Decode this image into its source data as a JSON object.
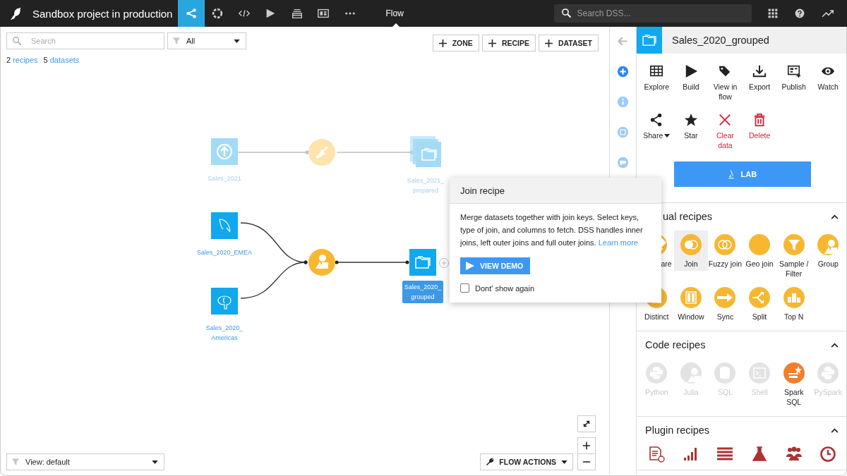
{
  "topbar": {
    "project_title": "Sandbox project in production",
    "nav": [
      {
        "kind": "flow",
        "selected": true
      },
      {
        "kind": "ring",
        "selected": false
      },
      {
        "kind": "code",
        "selected": false
      },
      {
        "kind": "play",
        "selected": false
      },
      {
        "kind": "stack",
        "selected": false
      },
      {
        "kind": "dashboard",
        "selected": false
      },
      {
        "kind": "more",
        "selected": false
      }
    ],
    "page_label": "Flow",
    "search_placeholder": "Search DSS..."
  },
  "toolbar": {
    "search_placeholder": "Search",
    "filter_value": "All",
    "buttons": [
      "ZONE",
      "RECIPE",
      "DATASET"
    ]
  },
  "counts": [
    {
      "number": "2",
      "label": "recipes"
    },
    {
      "number": "5",
      "label": "datasets"
    }
  ],
  "flow": {
    "nodes": [
      {
        "kind": "upload",
        "label": "Sales_2021",
        "faded": true,
        "selected": false
      },
      {
        "kind": "prepare",
        "faded": true
      },
      {
        "kind": "folder-stack",
        "label": "Sales_2021_\nprepared",
        "faded": true,
        "selected": false
      },
      {
        "kind": "dolphin",
        "label": "Sales_2020_EMEA",
        "faded": false,
        "selected": false
      },
      {
        "kind": "group",
        "faded": false
      },
      {
        "kind": "folder",
        "label": "Sales_2020_\ngrouped",
        "faded": false,
        "selected": true
      },
      {
        "kind": "elephant",
        "label": "Sales_2020_\nAmericas",
        "faded": false,
        "selected": false
      }
    ]
  },
  "bottom": {
    "view_value": "View: default",
    "flow_actions": "FLOW ACTIONS"
  },
  "popover": {
    "title": "Join recipe",
    "text": "Merge datasets together with join keys. Select keys, type of join, and columns to fetch. DSS handles inner joins, left outer joins and full outer joins.",
    "link": "Learn more",
    "button": "VIEW DEMO",
    "dont_show_again": {
      "label": "Dont' show again",
      "checked": false
    }
  },
  "panel": {
    "title": "Sales_2020_grouped",
    "actions": [
      {
        "kind": "table",
        "label": "Explore",
        "danger": false
      },
      {
        "kind": "play",
        "label": "Build",
        "danger": false
      },
      {
        "kind": "tag",
        "label": "View in flow",
        "danger": false
      },
      {
        "kind": "download",
        "label": "Export",
        "danger": false
      },
      {
        "kind": "publish",
        "label": "Publish",
        "danger": false
      },
      {
        "kind": "eye",
        "label": "Watch",
        "danger": false
      },
      {
        "kind": "share",
        "label": "Share",
        "danger": false
      },
      {
        "kind": "star",
        "label": "Star",
        "danger": false
      },
      {
        "kind": "cross",
        "label": "Clear data",
        "danger": true
      },
      {
        "kind": "trash",
        "label": "Delete",
        "danger": true
      }
    ],
    "lab_button": "LAB",
    "sections": [
      {
        "title": "ual recipes",
        "expanded": true,
        "items": [
          {
            "kind": "prepare",
            "label": "are",
            "selected": false
          },
          {
            "kind": "join",
            "label": "Join",
            "selected": true
          },
          {
            "kind": "fuzzy",
            "label": "Fuzzy join",
            "selected": false
          },
          {
            "kind": "geo",
            "label": "Geo join",
            "selected": false
          },
          {
            "kind": "funnel",
            "label": "Sample / Filter",
            "selected": false
          },
          {
            "kind": "group",
            "label": "Group",
            "selected": false
          },
          {
            "kind": "distinct",
            "label": "Distinct",
            "selected": false
          },
          {
            "kind": "window",
            "label": "Window",
            "selected": false
          },
          {
            "kind": "sync",
            "label": "Sync",
            "selected": false
          },
          {
            "kind": "split",
            "label": "Split",
            "selected": false
          },
          {
            "kind": "podium",
            "label": "Top N",
            "selected": false
          }
        ]
      },
      {
        "title": "Code recipes",
        "expanded": true,
        "items": [
          {
            "kind": "python",
            "label": "Python",
            "enabled": false
          },
          {
            "kind": "group",
            "label": "Julia",
            "enabled": false
          },
          {
            "kind": "database",
            "label": "SQL",
            "enabled": false
          },
          {
            "kind": "terminal",
            "label": "Shell",
            "enabled": false
          },
          {
            "kind": "spark",
            "label": "Spark SQL",
            "enabled": true
          },
          {
            "kind": "python",
            "label": "PySpark",
            "enabled": false
          }
        ]
      },
      {
        "title": "Plugin recipes",
        "expanded": true,
        "items": [
          {
            "kind": "doc-bulb"
          },
          {
            "kind": "bars"
          },
          {
            "kind": "lines"
          },
          {
            "kind": "flask"
          },
          {
            "kind": "people"
          },
          {
            "kind": "clock"
          }
        ]
      }
    ]
  }
}
